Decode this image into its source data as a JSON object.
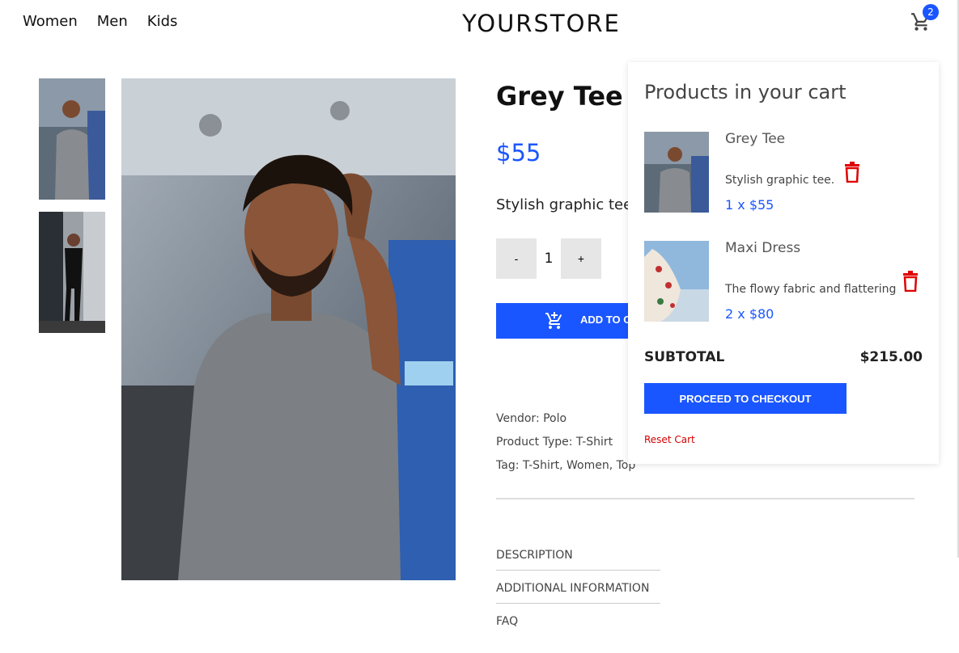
{
  "nav": {
    "items": [
      "Women",
      "Men",
      "Kids"
    ]
  },
  "brand": "YOURSTORE",
  "cart": {
    "count": "2"
  },
  "product": {
    "title": "Grey Tee",
    "price": "$55",
    "description": "Stylish graphic tee.",
    "quantity": "1",
    "minus_label": "-",
    "plus_label": "+",
    "add_to_cart_label": "ADD TO CART",
    "vendor": "Vendor: Polo",
    "product_type": "Product Type: T-Shirt",
    "tags": "Tag: T-Shirt, Women, Top",
    "tabs": [
      "DESCRIPTION",
      "ADDITIONAL INFORMATION",
      "FAQ"
    ]
  },
  "cart_panel": {
    "heading": "Products in your cart",
    "items": [
      {
        "name": "Grey Tee",
        "description": "Stylish graphic tee.",
        "price_line": "1 x $55"
      },
      {
        "name": "Maxi Dress",
        "description": "The flowy fabric and flattering",
        "price_line": "2 x $80"
      }
    ],
    "subtotal_label": "SUBTOTAL",
    "subtotal_value": "$215.00",
    "checkout_label": "PROCEED TO CHECKOUT",
    "reset_label": "Reset Cart"
  },
  "colors": {
    "accent": "#1a56ff",
    "danger": "#d40000"
  }
}
